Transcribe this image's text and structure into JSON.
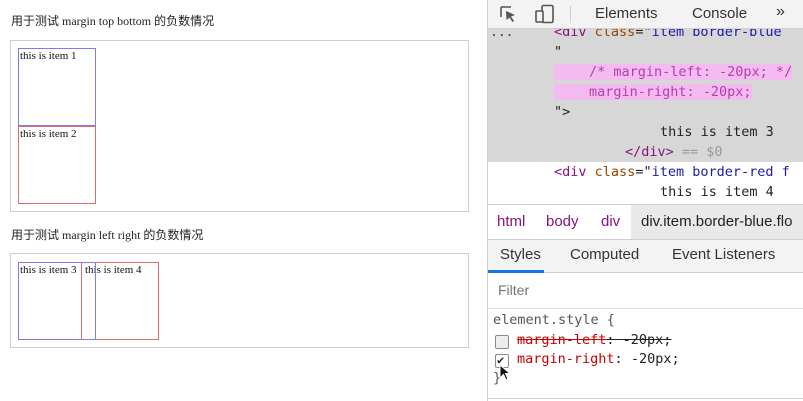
{
  "page": {
    "section1_heading": "用于测试 margin top bottom 的负数情况",
    "section2_heading": "用于测试 margin left right 的负数情况",
    "section1_items": [
      "this is item 1",
      "this is item 2"
    ],
    "section2_items": [
      "this is item 3",
      "this is item 4"
    ]
  },
  "devtools": {
    "toolbar": {
      "tabs": [
        "Elements",
        "Console"
      ],
      "more": "»",
      "icons": [
        "inspect-cursor-icon",
        "device-toolbar-icon"
      ]
    },
    "dom": {
      "line1": {
        "open": "<",
        "tag": "div",
        "attr": "class",
        "eq": "=\"",
        "val": "item border-blue"
      },
      "line2": "\"",
      "line3": "/* margin-left: -20px; */",
      "line4": "margin-right: -20px;",
      "line5": "\">",
      "line6": "this is item 3",
      "line7_close": "</div>",
      "line7_ref": " == $0",
      "line8": {
        "open": "<",
        "tag": "div",
        "attr": "class",
        "eq": "=\"",
        "val": "item border-red f"
      },
      "line9": "this is item 4",
      "ellipsis": "..."
    },
    "breadcrumb": [
      "html",
      "body",
      "div",
      "div.item.border-blue.flo"
    ],
    "subtabs": [
      "Styles",
      "Computed",
      "Event Listeners"
    ],
    "filter_placeholder": "Filter",
    "styles": {
      "selector": "element.style {",
      "rules": [
        {
          "prop": "margin-left",
          "value": "-20px;",
          "checked": false
        },
        {
          "prop": "margin-right",
          "value": "-20px;",
          "checked": true
        }
      ],
      "close": "}"
    },
    "colors": {
      "accent": "#1a73e8",
      "tag": "#881280",
      "prop": "#c80000",
      "comment_bg": "#f3bbf0"
    }
  }
}
